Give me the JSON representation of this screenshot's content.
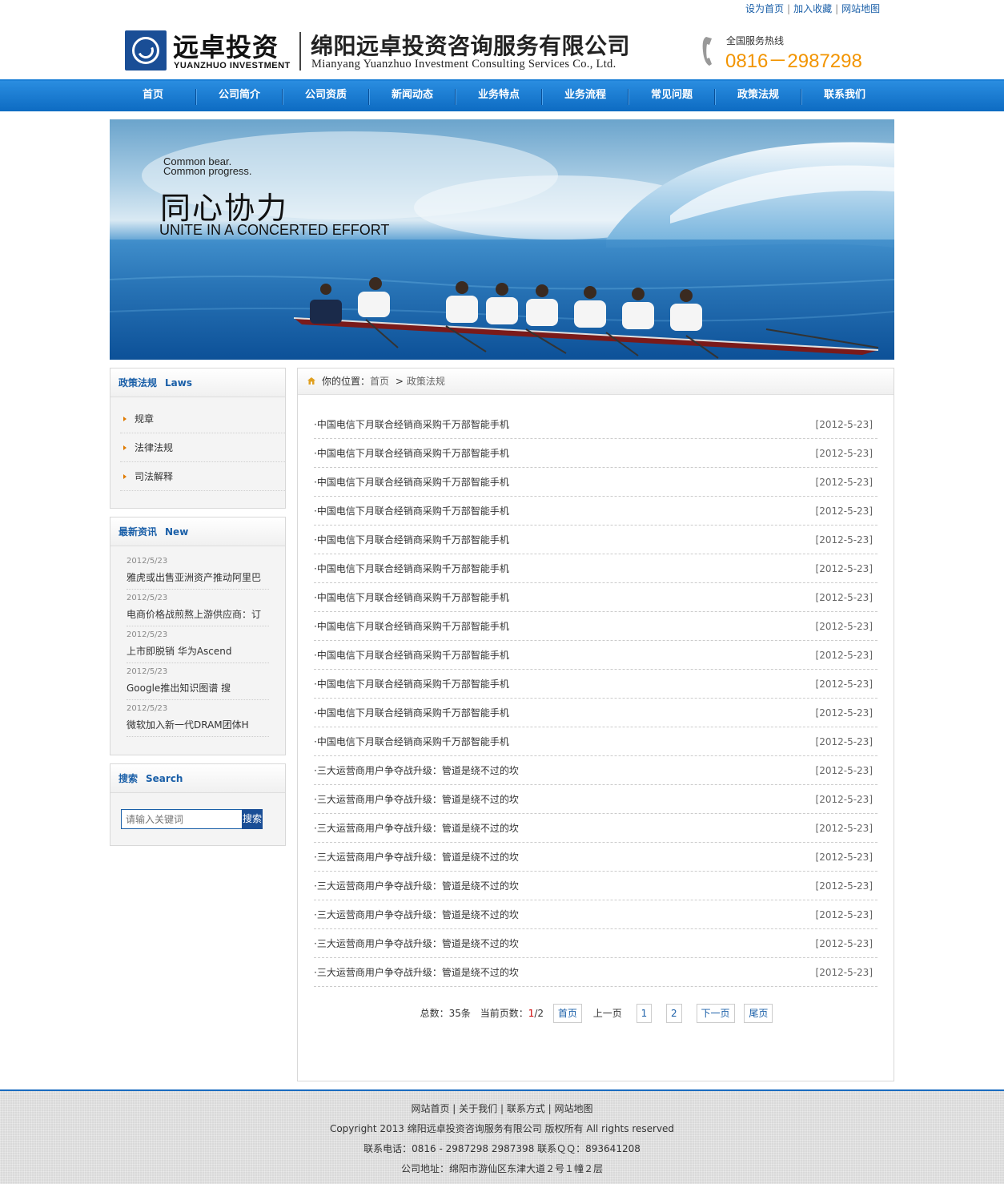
{
  "toplinks": [
    "设为首页",
    "加入收藏",
    "网站地图"
  ],
  "header": {
    "logo_cn": "远卓投资",
    "logo_en": "YUANZHUO INVESTMENT",
    "company_cn": "绵阳远卓投资咨询服务有限公司",
    "company_en": "Mianyang Yuanzhuo Investment Consulting Services Co., Ltd.",
    "hotline_label": "全国服务热线",
    "hotline_number": "0816－2987298"
  },
  "nav": [
    "首页",
    "公司简介",
    "公司资质",
    "新闻动态",
    "业务特点",
    "业务流程",
    "常见问题",
    "政策法规",
    "联系我们"
  ],
  "banner": {
    "line1": "Common bear.",
    "line2": "Common progress.",
    "title_cn": "同心协力",
    "title_en": "UNITE IN A CONCERTED EFFORT"
  },
  "sidebar": {
    "laws": {
      "title": "政策法规",
      "title_en": "Laws",
      "items": [
        "规章",
        "法律法规",
        "司法解释"
      ]
    },
    "news": {
      "title": "最新资讯",
      "title_en": "New",
      "items": [
        {
          "date": "2012/5/23",
          "title": "雅虎或出售亚洲资产推动阿里巴"
        },
        {
          "date": "2012/5/23",
          "title": "电商价格战煎熬上游供应商：订"
        },
        {
          "date": "2012/5/23",
          "title": "上市即脱销 华为Ascend"
        },
        {
          "date": "2012/5/23",
          "title": "Google推出知识图谱 搜"
        },
        {
          "date": "2012/5/23",
          "title": "微软加入新一代DRAM团体H"
        }
      ]
    },
    "search": {
      "title": "搜索",
      "title_en": "Search",
      "placeholder": "请输入关键词",
      "button": "搜索"
    }
  },
  "main": {
    "breadcrumb_label": "你的位置：",
    "breadcrumb_home": "首页",
    "breadcrumb_sep": ">",
    "breadcrumb_current": "政策法规",
    "articles": [
      {
        "title": "·中国电信下月联合经销商采购千万部智能手机",
        "date": "[2012-5-23]"
      },
      {
        "title": "·中国电信下月联合经销商采购千万部智能手机",
        "date": "[2012-5-23]"
      },
      {
        "title": "·中国电信下月联合经销商采购千万部智能手机",
        "date": "[2012-5-23]"
      },
      {
        "title": "·中国电信下月联合经销商采购千万部智能手机",
        "date": "[2012-5-23]"
      },
      {
        "title": "·中国电信下月联合经销商采购千万部智能手机",
        "date": "[2012-5-23]"
      },
      {
        "title": "·中国电信下月联合经销商采购千万部智能手机",
        "date": "[2012-5-23]"
      },
      {
        "title": "·中国电信下月联合经销商采购千万部智能手机",
        "date": "[2012-5-23]"
      },
      {
        "title": "·中国电信下月联合经销商采购千万部智能手机",
        "date": "[2012-5-23]"
      },
      {
        "title": "·中国电信下月联合经销商采购千万部智能手机",
        "date": "[2012-5-23]"
      },
      {
        "title": "·中国电信下月联合经销商采购千万部智能手机",
        "date": "[2012-5-23]"
      },
      {
        "title": "·中国电信下月联合经销商采购千万部智能手机",
        "date": "[2012-5-23]"
      },
      {
        "title": "·中国电信下月联合经销商采购千万部智能手机",
        "date": "[2012-5-23]"
      },
      {
        "title": "·三大运营商用户争夺战升级：管道是绕不过的坎",
        "date": "[2012-5-23]"
      },
      {
        "title": "·三大运营商用户争夺战升级：管道是绕不过的坎",
        "date": "[2012-5-23]"
      },
      {
        "title": "·三大运营商用户争夺战升级：管道是绕不过的坎",
        "date": "[2012-5-23]"
      },
      {
        "title": "·三大运营商用户争夺战升级：管道是绕不过的坎",
        "date": "[2012-5-23]"
      },
      {
        "title": "·三大运营商用户争夺战升级：管道是绕不过的坎",
        "date": "[2012-5-23]"
      },
      {
        "title": "·三大运营商用户争夺战升级：管道是绕不过的坎",
        "date": "[2012-5-23]"
      },
      {
        "title": "·三大运营商用户争夺战升级：管道是绕不过的坎",
        "date": "[2012-5-23]"
      },
      {
        "title": "·三大运营商用户争夺战升级：管道是绕不过的坎",
        "date": "[2012-5-23]"
      }
    ],
    "pager": {
      "total_label": "总数：35条",
      "current_label": "当前页数：",
      "current": "1",
      "pages_total": "/2",
      "first": "首页",
      "prev": "上一页",
      "page1": "1",
      "page2": "2",
      "next": "下一页",
      "last": "尾页"
    }
  },
  "footer": {
    "links": "网站首页 | 关于我们 | 联系方式 | 网站地图",
    "copyright": "Copyright 2013   绵阳远卓投资咨询服务有限公司 版权所有 All rights reserved",
    "contact": "联系电话：0816 - 2987298 2987398  联系ＱＱ：893641208",
    "address": "公司地址：绵阳市游仙区东津大道２号１幢２层"
  }
}
